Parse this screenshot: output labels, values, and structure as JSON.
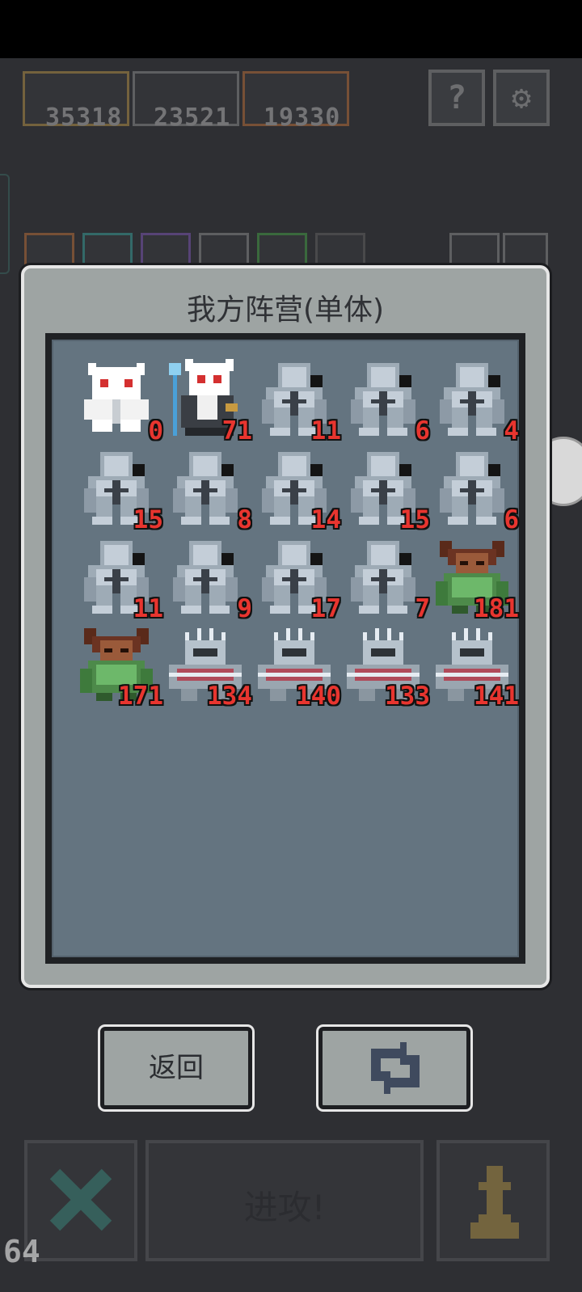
{
  "hud": {
    "resources": [
      "35318",
      "23521",
      "19330"
    ],
    "help_icon": "question-icon",
    "settings_icon": "gear-icon"
  },
  "dialog": {
    "title": "我方阵营(单体)"
  },
  "units": [
    {
      "type": "white-ghost",
      "count": "0"
    },
    {
      "type": "white-mage",
      "count": "71"
    },
    {
      "type": "grey-golem",
      "count": "11"
    },
    {
      "type": "grey-golem",
      "count": "6"
    },
    {
      "type": "grey-golem",
      "count": "4"
    },
    {
      "type": "grey-golem",
      "count": "15"
    },
    {
      "type": "grey-golem",
      "count": "8"
    },
    {
      "type": "grey-golem",
      "count": "14"
    },
    {
      "type": "grey-golem",
      "count": "15"
    },
    {
      "type": "grey-golem",
      "count": "6"
    },
    {
      "type": "grey-golem",
      "count": "11"
    },
    {
      "type": "grey-golem",
      "count": "9"
    },
    {
      "type": "grey-golem",
      "count": "17"
    },
    {
      "type": "grey-golem",
      "count": "7"
    },
    {
      "type": "horned-beast",
      "count": "181"
    },
    {
      "type": "horned-beast",
      "count": "171"
    },
    {
      "type": "spiked-knight",
      "count": "134"
    },
    {
      "type": "spiked-knight",
      "count": "140"
    },
    {
      "type": "spiked-knight",
      "count": "133"
    },
    {
      "type": "spiked-knight",
      "count": "141"
    }
  ],
  "buttons": {
    "back_label": "返回",
    "refresh_icon": "refresh-icon",
    "attack_label": "进攻!",
    "close_icon": "close-icon",
    "pawn_icon": "pawn-icon"
  },
  "fps": "64",
  "colors": {
    "count_red": "#e8352f",
    "panel_bg": "#647480",
    "dialog_bg": "#9ea4a3"
  }
}
